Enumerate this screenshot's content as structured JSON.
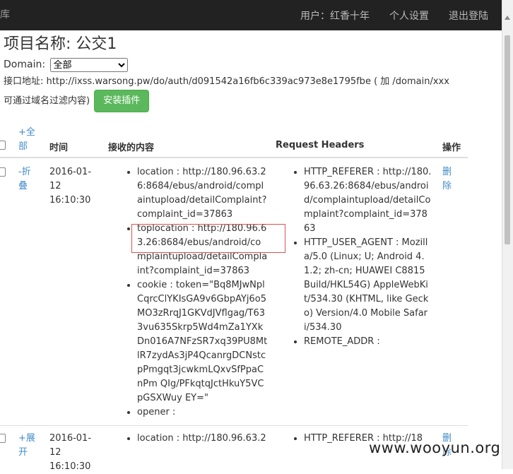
{
  "topbar": {
    "brand": "库",
    "user": "用户：红香十年",
    "settings": "个人设置",
    "logout": "退出登陆"
  },
  "project": {
    "title": "项目名称: 公交1"
  },
  "domain": {
    "label": "Domain:",
    "selected": "全部"
  },
  "interface": {
    "text": "接口地址: http://ixss.warsong.pw/do/auth/d091542a16fb6c339ac973e8e1795fbe ( 加 /domain/xxx 可通过域名过滤内容)",
    "install_button": "安装插件"
  },
  "table": {
    "headers": {
      "toggle_all": "+全部",
      "time": "时间",
      "content": "接收的内容",
      "request_headers": "Request Headers",
      "action": "操作"
    },
    "rows": [
      {
        "toggle": "-折叠",
        "time": "2016-01-12 16:10:30",
        "content": [
          "location : http://180.96.63.26:8684/ebus/android/complaintupload/detailComplaint?complaint_id=37863",
          "toplocation : http://180.96.63.26:8684/ebus/android/complaintupload/detailComplaint?complaint_id=37863",
          "cookie : token=\"Bq8MJwNplCqrcClYKIsGA9v6GbpAYj6o5MO3zRrqJ1GKVdJVflgag/T633vu635Skrp5Wd4mZa1YXkDn016A7NFzSR7xq39PU8MtlR7zydAs3jP4QcanrgDCNstcpPmgqt3jcwkmLQxvSfPpaCnPm QIg/PFkqtqJctHkuY5VCpGSXWuy EY=\"",
          "opener :"
        ],
        "headers": [
          "HTTP_REFERER : http://180.96.63.26:8684/ebus/android/complaintupload/detailComplaint?complaint_id=37863",
          "HTTP_USER_AGENT : Mozilla/5.0 (Linux; U; Android 4.1.2; zh-cn; HUAWEI C8815 Build/HKL54G) AppleWebKit/534.30 (KHTML, like Gecko) Version/4.0 Mobile Safari/534.30",
          "REMOTE_ADDR :"
        ],
        "action": "删除"
      },
      {
        "toggle": "+展开",
        "time": "2016-01-12 16:10:30",
        "content": [
          "location : http://180.96.63.2"
        ],
        "headers": [
          "HTTP_REFERER : http://18"
        ],
        "action": "删除"
      }
    ]
  },
  "watermark": "www.wooyun.org",
  "colors": {
    "topbar": "#222222",
    "link": "#428bca",
    "install": "#5cb85c",
    "highlight_box": "#d9534f"
  }
}
